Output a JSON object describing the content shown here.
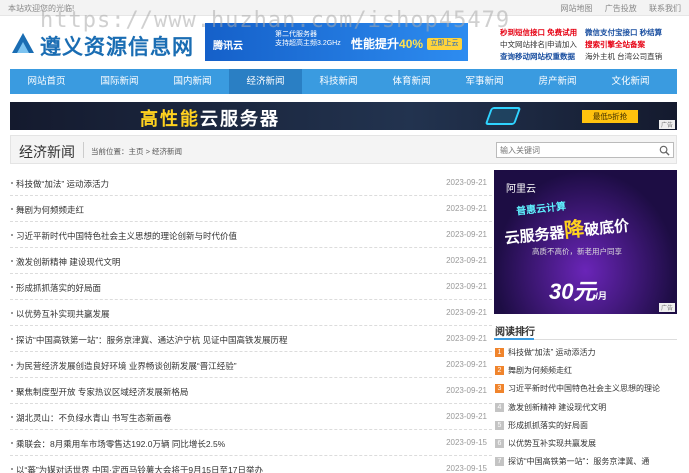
{
  "topbar": {
    "welcome": "本站欢迎您的光临!",
    "links": [
      "网站地图",
      "广告投放",
      "联系我们"
    ]
  },
  "watermark": "https://www.huzhan.com/ishop45479",
  "site": {
    "name": "遵义资源信息网",
    "brand_color": "#1a6db3"
  },
  "top_ad": {
    "brand": "腾讯云",
    "sub1": "第二代服务器",
    "sub2": "支持超高主频3.2GHz",
    "headline_pre": "性能提升",
    "headline_num": "40%",
    "button": "立即上云"
  },
  "promo": {
    "col1": [
      "秒到短信接口 免费试用",
      "中文网站排名|申请加入",
      "查询移动网站权重数据"
    ],
    "col2": [
      "微信支付宝接口 秒结算",
      "搜索引擎全站备案",
      "海外主机 台湾公司直销"
    ]
  },
  "nav": {
    "active_index": 2,
    "items": [
      "网站首页",
      "国际新闻",
      "国内新闻",
      "经济新闻",
      "科技新闻",
      "体育新闻",
      "军事新闻",
      "房产新闻",
      "文化新闻"
    ]
  },
  "banner": {
    "text_pre": "高性能",
    "text_post": "云服务器",
    "button": "最低5折抢",
    "ad_tag": "广告"
  },
  "crumb": {
    "title": "经济新闻",
    "location": "当前位置：主页 > 经济新闻",
    "search_placeholder": "输入关键词"
  },
  "news": [
    {
      "title": "科技做“加法” 运动添活力",
      "date": "2023-09-21"
    },
    {
      "title": "舞剧为何频频走红",
      "date": "2023-09-21"
    },
    {
      "title": "习近平新时代中国特色社会主义思想的理论创新与时代价值",
      "date": "2023-09-21"
    },
    {
      "title": "激发创新精神 建设现代文明",
      "date": "2023-09-21"
    },
    {
      "title": "形成抓抓落实的好局面",
      "date": "2023-09-21"
    },
    {
      "title": "以优势互补实现共赢发展",
      "date": "2023-09-21"
    },
    {
      "title": "探访“中国高铁第一站”：服务京津冀、通达沪宁杭 见证中国高铁发展历程",
      "date": "2023-09-21"
    },
    {
      "title": "为民营经济发展创造良好环境 业界畅谈创新发展“晋江经验”",
      "date": "2023-09-21"
    },
    {
      "title": "聚焦制度型开放 专家热议区域经济发展新格局",
      "date": "2023-09-21"
    },
    {
      "title": "湖北灵山：不负绿水青山 书写生态新画卷",
      "date": "2023-09-21"
    },
    {
      "title": "乘联会：8月乘用车市场零售达192.0万辆 同比增长2.5%",
      "date": "2023-09-15"
    },
    {
      "title": "以“蕃”为媒对话世界 中国·定西马铃薯大会将于9月15日至17日举办",
      "date": "2023-09-15"
    }
  ],
  "side_ad": {
    "brand": "阿里云",
    "line1": "普惠云计算",
    "line2_pre": "云服务器",
    "line2_em": "降",
    "line2_post": "破底价",
    "line3": "高质不高价，新老用户同享",
    "price": "30元",
    "unit": "/月",
    "ad_tag": "广告"
  },
  "rank": {
    "title": "阅读排行",
    "items": [
      "科技做“加法” 运动添活力",
      "舞剧为何频频走红",
      "习近平新时代中国特色社会主义思想的理论",
      "激发创新精神 建设现代文明",
      "形成抓抓落实的好局面",
      "以优势互补实现共赢发展",
      "探访“中国高铁第一站”：服务京津冀、通"
    ]
  }
}
